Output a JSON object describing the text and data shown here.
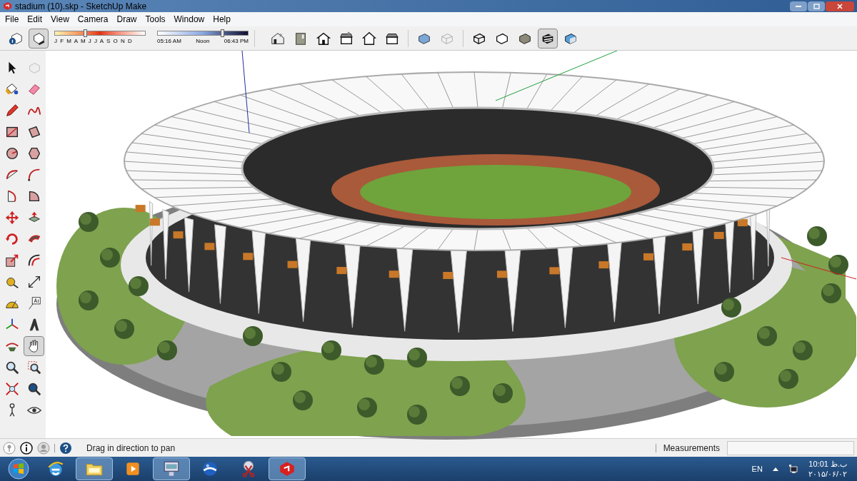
{
  "window": {
    "title": "stadium (10).skp - SketchUp Make"
  },
  "menu": [
    "File",
    "Edit",
    "View",
    "Camera",
    "Draw",
    "Tools",
    "Window",
    "Help"
  ],
  "toolbar": {
    "shadow_buttons": [
      {
        "selected": false
      },
      {
        "selected": true
      }
    ],
    "date_slider": {
      "labels": "J F M A M J J A S O N D",
      "level": 0.33
    },
    "time_slider": {
      "start": "05:16 AM",
      "middle": "Noon",
      "end": "06:43 PM",
      "level": 0.72
    },
    "view_buttons": [
      {
        "selected": false
      },
      {
        "selected": false
      },
      {
        "selected": false
      },
      {
        "selected": false
      },
      {
        "selected": false
      },
      {
        "selected": false
      }
    ],
    "style_buttons": [
      {
        "selected": false
      },
      {
        "selected": false
      },
      {
        "selected": false
      },
      {
        "selected": false
      },
      {
        "selected": false
      },
      {
        "selected": true
      },
      {
        "selected": false
      }
    ]
  },
  "tools": [
    {
      "selected": false
    },
    {
      "selected": false
    },
    {
      "selected": false
    },
    {
      "selected": false
    },
    {
      "selected": false
    },
    {
      "selected": false
    },
    {
      "selected": false
    },
    {
      "selected": false
    },
    {
      "selected": false
    },
    {
      "selected": false
    },
    {
      "selected": false
    },
    {
      "selected": false
    },
    {
      "selected": false
    },
    {
      "selected": false
    },
    {
      "selected": false
    },
    {
      "selected": false
    },
    {
      "selected": false
    },
    {
      "selected": false
    },
    {
      "selected": false
    },
    {
      "selected": false
    },
    {
      "selected": false
    },
    {
      "selected": false
    },
    {
      "selected": false
    },
    {
      "selected": false
    },
    {
      "selected": false
    },
    {
      "selected": false
    },
    {
      "selected": false
    },
    {
      "selected": true
    },
    {
      "selected": false
    },
    {
      "selected": false
    },
    {
      "selected": false
    },
    {
      "selected": false
    },
    {
      "selected": false
    },
    {
      "selected": false
    }
  ],
  "status_bar": {
    "hint": "Drag in direction to pan",
    "measurements_label": "Measurements"
  },
  "taskbar": {
    "apps": [
      {
        "running": false
      },
      {
        "running": true
      },
      {
        "running": false
      },
      {
        "running": true
      },
      {
        "running": false
      },
      {
        "running": false
      },
      {
        "running": true
      }
    ],
    "language": "EN",
    "time": "10:01 ب.ظ",
    "date": "۲۰۱۵/۰۶/۰۲"
  }
}
